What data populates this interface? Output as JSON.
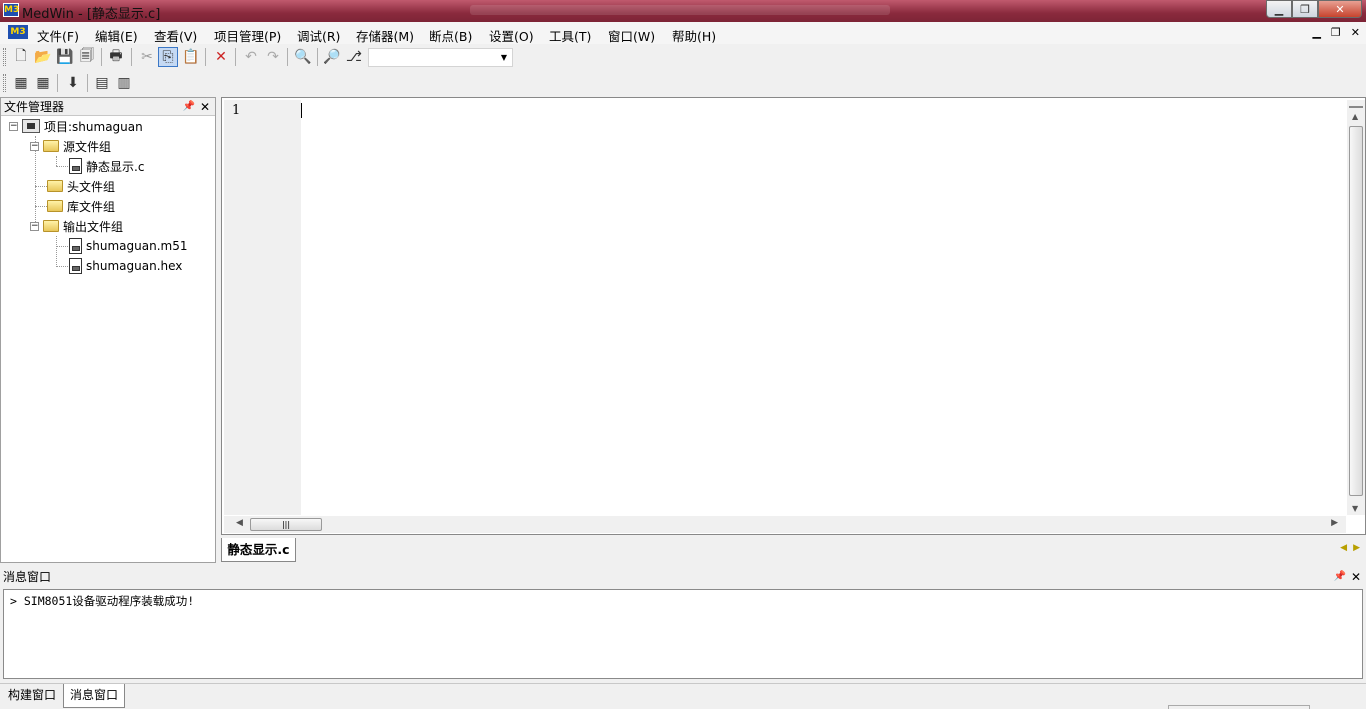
{
  "window": {
    "title": "MedWin - [静态显示.c]",
    "app_icon": "medwin-icon"
  },
  "menu": {
    "items": [
      "文件(F)",
      "编辑(E)",
      "查看(V)",
      "项目管理(P)",
      "调试(R)",
      "存储器(M)",
      "断点(B)",
      "设置(O)",
      "工具(T)",
      "窗口(W)",
      "帮助(H)"
    ]
  },
  "file_manager": {
    "title": "文件管理器",
    "tree": {
      "project": "项目:shumaguan",
      "source_group": "源文件组",
      "source_file": "静态显示.c",
      "header_group": "头文件组",
      "library_group": "库文件组",
      "output_group": "输出文件组",
      "output_files": [
        "shumaguan.m51",
        "shumaguan.hex"
      ]
    }
  },
  "editor": {
    "line_number": "1",
    "content": ""
  },
  "editor_tabs": {
    "active": "静态显示.c"
  },
  "message_window": {
    "title": "消息窗口",
    "message": "> SIM8051设备驱动程序装载成功!"
  },
  "bottom_tabs": {
    "build": "构建窗口",
    "message": "消息窗口"
  },
  "colors": {
    "title_bar": "#8a2a3d",
    "accent": "#1e4fb0"
  }
}
